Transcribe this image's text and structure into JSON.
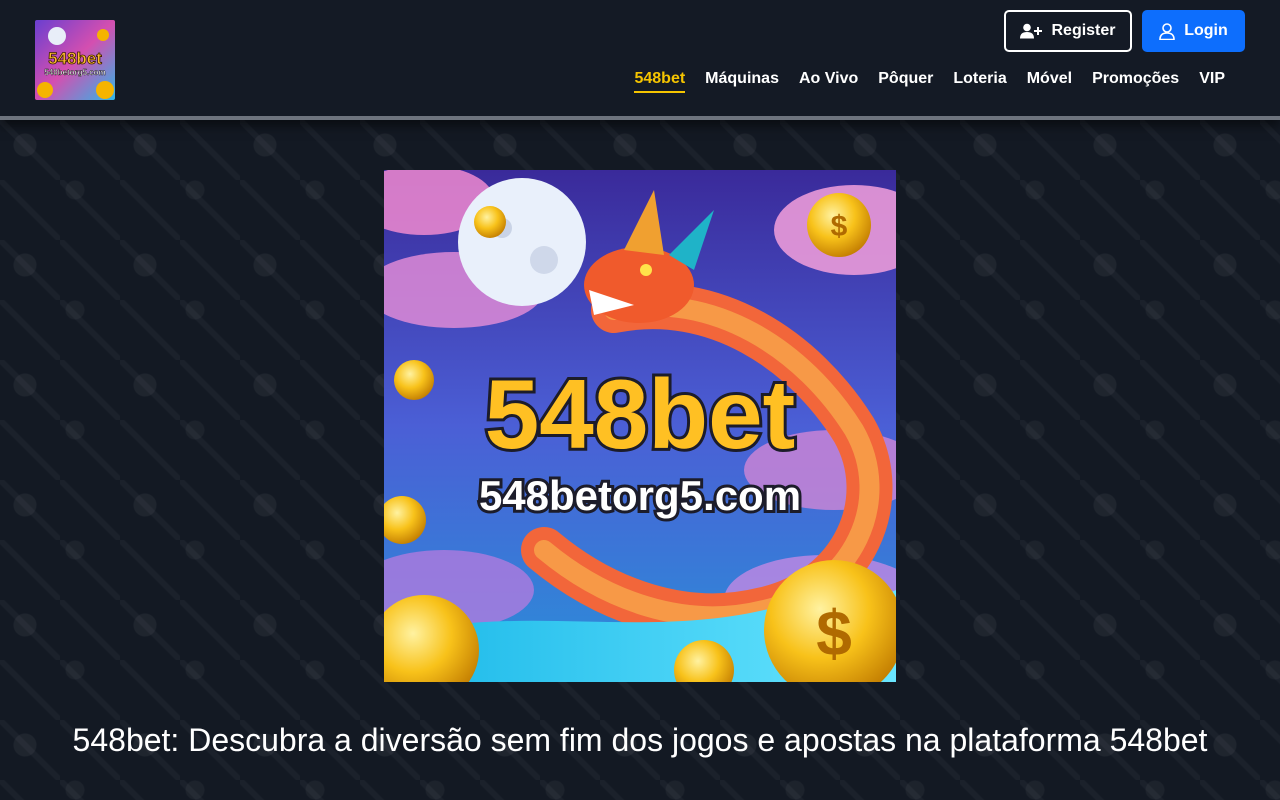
{
  "header": {
    "logo": {
      "brand": "548bet",
      "domain": "548betorg5.com"
    },
    "register_label": "Register",
    "login_label": "Login",
    "nav": [
      {
        "label": "548bet",
        "active": true
      },
      {
        "label": "Máquinas"
      },
      {
        "label": "Ao Vivo"
      },
      {
        "label": "Pôquer"
      },
      {
        "label": "Loteria"
      },
      {
        "label": "Móvel"
      },
      {
        "label": "Promoções"
      },
      {
        "label": "VIP"
      }
    ],
    "icons": {
      "register": "user-plus-icon",
      "login": "user-icon"
    }
  },
  "hero": {
    "brand": "548bet",
    "domain": "548betorg5.com"
  },
  "main": {
    "headline": "548bet: Descubra a diversão sem fim dos jogos e apostas na plataforma 548bet"
  },
  "colors": {
    "background": "#131923",
    "header": "#141a25",
    "accent": "#f5c400",
    "login": "#0d6efd"
  }
}
